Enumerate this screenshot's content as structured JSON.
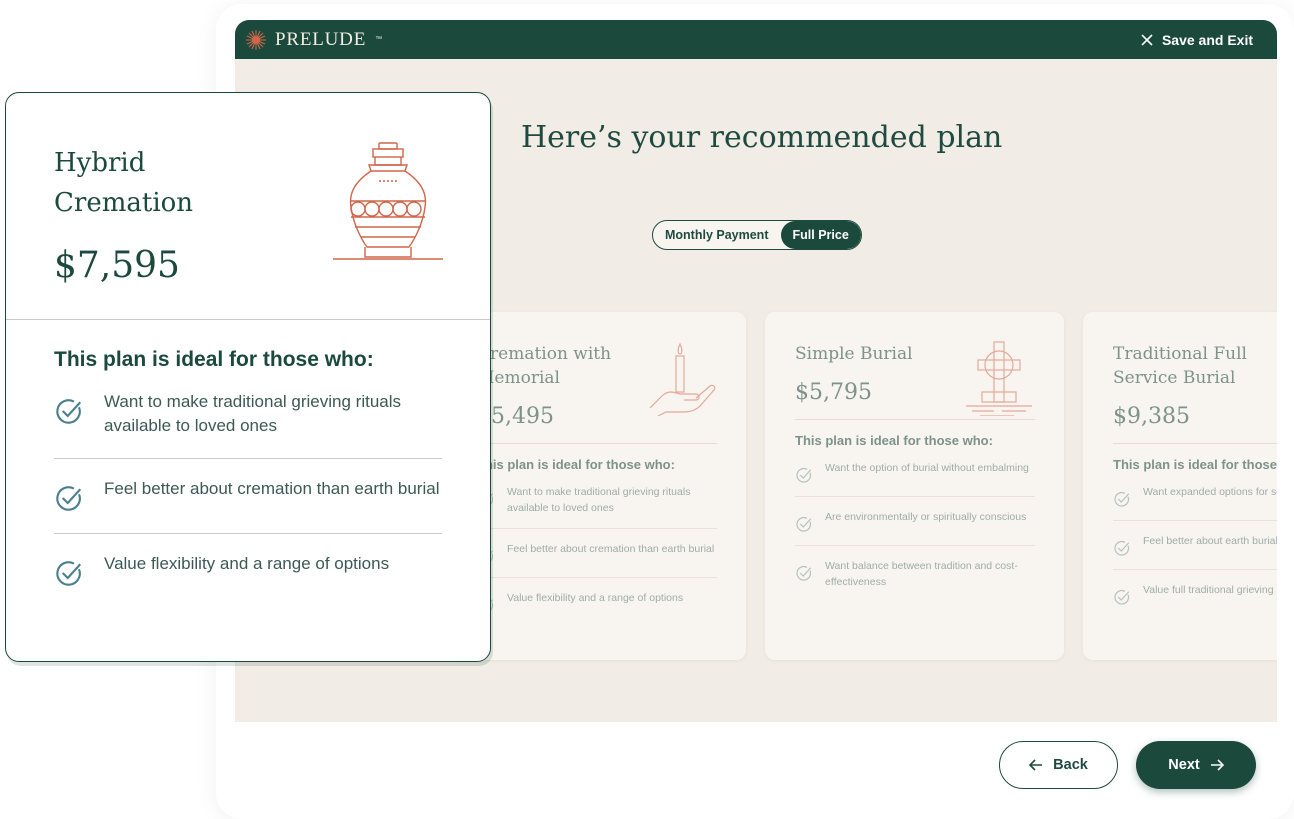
{
  "header": {
    "brand": "PRELUDE",
    "trademark": "™",
    "save_exit": "Save and Exit"
  },
  "main": {
    "title": "Here’s your recommended plan",
    "toggle": {
      "options": [
        "Monthly Payment",
        "Full Price"
      ],
      "selected": "Full Price"
    },
    "cards": [
      {
        "title": "Cremation with Memorial",
        "price": "$5,495",
        "icon": "candle-hand-icon",
        "subtitle": "This plan is ideal for those who:",
        "items": [
          "Want to make traditional grieving rituals available to loved ones",
          "Feel better about cremation than earth burial",
          "Value flexibility and a range of options"
        ]
      },
      {
        "title": "Simple Burial",
        "price": "$5,795",
        "icon": "celtic-cross-icon",
        "subtitle": "This plan is ideal for those who:",
        "items": [
          "Want the option of burial without embalming",
          "Are environmentally or spiritually conscious",
          "Want balance between tradition and cost-effectiveness"
        ]
      },
      {
        "title": "Traditional Full Service Burial",
        "price": "$9,385",
        "icon": "casket-icon",
        "subtitle": "This plan is ideal for those who:",
        "items": [
          "Want expanded options for service",
          "Feel better about earth burial than cremation",
          "Value full traditional grieving"
        ]
      }
    ]
  },
  "feature": {
    "title": "Hybrid Cremation",
    "price": "$7,595",
    "icon": "urn-icon",
    "subtitle": "This plan is ideal for those who:",
    "items": [
      "Want to make traditional grieving rituals available to loved ones",
      "Feel better about cremation than earth burial",
      "Value flexibility and a range of options"
    ]
  },
  "footer": {
    "back": "Back",
    "next": "Next"
  },
  "colors": {
    "brand_green": "#1b4a3c",
    "accent_terracotta": "#d0654a",
    "background_beige": "#f1ece5"
  }
}
